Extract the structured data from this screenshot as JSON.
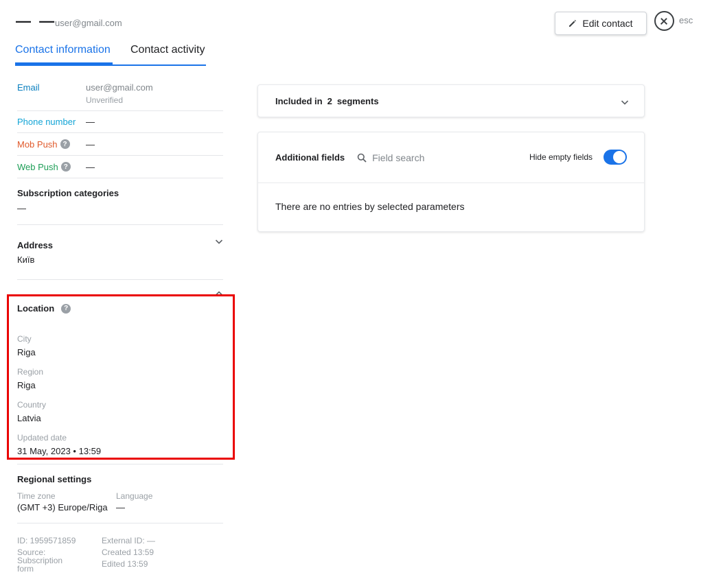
{
  "header": {
    "name": "— —",
    "email": "user@gmail.com",
    "edit_label": "Edit contact",
    "esc_label": "esc"
  },
  "tabs": [
    {
      "label": "Contact information",
      "active": true
    },
    {
      "label": "Contact activity",
      "active": false
    }
  ],
  "channels": {
    "email": {
      "label": "Email",
      "value": "user@gmail.com",
      "status": "Unverified"
    },
    "phone": {
      "label": "Phone number",
      "value": "—"
    },
    "mob_push": {
      "label": "Mob Push",
      "value": "—"
    },
    "web_push": {
      "label": "Web Push",
      "value": "—"
    }
  },
  "subscription": {
    "title": "Subscription categories",
    "value": "—"
  },
  "address": {
    "title": "Address",
    "value": "Київ"
  },
  "location": {
    "title": "Location",
    "city": {
      "label": "City",
      "value": "Riga"
    },
    "region": {
      "label": "Region",
      "value": "Riga"
    },
    "country": {
      "label": "Country",
      "value": "Latvia"
    },
    "updated": {
      "label": "Updated date",
      "value": "31 May, 2023 • 13:59"
    }
  },
  "regional": {
    "title": "Regional settings",
    "timezone": {
      "label": "Time zone",
      "value": "(GMT +3) Europe/Riga"
    },
    "language": {
      "label": "Language",
      "value": "—"
    }
  },
  "meta": {
    "id": "ID: 1959571859",
    "source": "Source: Subscription form",
    "external_id": "External ID: —",
    "created": "Created 13:59",
    "edited": "Edited 13:59"
  },
  "segments": {
    "prefix": "Included in",
    "count": "2",
    "suffix": "segments"
  },
  "additional": {
    "title": "Additional fields",
    "search_placeholder": "Field search",
    "hide_label": "Hide empty fields",
    "hide_enabled": true,
    "empty_message": "There are no entries by selected parameters"
  },
  "colors": {
    "accent": "#1a73e8",
    "email": "#0a7fbf",
    "phone": "#12a4d6",
    "mob_push": "#e0592a",
    "web_push": "#1e9e57",
    "highlight": "#ea0000"
  }
}
